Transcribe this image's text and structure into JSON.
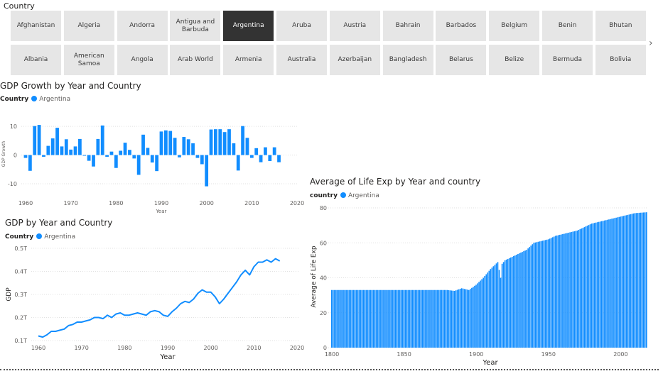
{
  "slicer": {
    "title": "Country",
    "row1": [
      "Afghanistan",
      "Algeria",
      "Andorra",
      "Antigua and Barbuda",
      "Argentina",
      "Aruba",
      "Austria",
      "Bahrain",
      "Barbados",
      "Belgium",
      "Benin",
      "Bhutan"
    ],
    "row2": [
      "Albania",
      "American Samoa",
      "Angola",
      "Arab World",
      "Armenia",
      "Australia",
      "Azerbaijan",
      "Bangladesh",
      "Belarus",
      "Belize",
      "Bermuda",
      "Bolivia"
    ],
    "selected": "Argentina",
    "next_icon": "chevron-right-icon"
  },
  "colors": {
    "accent": "#118DFF",
    "selected_tile": "#333333",
    "tile": "#E6E6E6"
  },
  "chart_data": [
    {
      "type": "bar",
      "title": "GDP Growth by Year and Country",
      "legend_title": "Country",
      "series": [
        {
          "name": "Argentina",
          "color": "#118DFF"
        }
      ],
      "xlabel": "Year",
      "ylabel": "GDP Growth",
      "xticks": [
        1960,
        1970,
        1980,
        1990,
        2000,
        2010,
        2020
      ],
      "yticks": [
        10,
        0,
        -10
      ],
      "ylim": [
        -11,
        12
      ],
      "x": [
        1960,
        1961,
        1962,
        1963,
        1964,
        1965,
        1966,
        1967,
        1968,
        1969,
        1970,
        1971,
        1972,
        1973,
        1974,
        1975,
        1976,
        1977,
        1978,
        1979,
        1980,
        1981,
        1982,
        1983,
        1984,
        1985,
        1986,
        1987,
        1988,
        1989,
        1990,
        1991,
        1992,
        1993,
        1994,
        1995,
        1996,
        1997,
        1998,
        1999,
        2000,
        2001,
        2002,
        2003,
        2004,
        2005,
        2006,
        2007,
        2008,
        2009,
        2010,
        2011,
        2012,
        2013,
        2014,
        2015,
        2016
      ],
      "values": [
        -1.0,
        -5.5,
        10.1,
        10.5,
        -0.6,
        3.2,
        5.8,
        9.5,
        3.0,
        5.5,
        1.9,
        3.0,
        5.6,
        -0.1,
        -2.0,
        -4.0,
        5.6,
        10.3,
        -0.6,
        1.2,
        -4.5,
        1.5,
        4.3,
        1.8,
        -1.2,
        -6.9,
        7.1,
        2.5,
        -2.6,
        -5.6,
        8.2,
        8.6,
        8.4,
        6.0,
        -0.8,
        6.3,
        5.5,
        4.1,
        -1.0,
        -3.2,
        -10.9,
        8.9,
        9.0,
        9.0,
        8.0,
        9.0,
        4.1,
        -5.4,
        10.1,
        6.0,
        -1.0,
        2.4,
        -2.5,
        2.7,
        -2.1,
        2.7,
        -2.5
      ]
    },
    {
      "type": "line",
      "title": "GDP by Year and Country",
      "legend_title": "Country",
      "series": [
        {
          "name": "Argentina",
          "color": "#118DFF"
        }
      ],
      "xlabel": "Year",
      "ylabel": "GDP",
      "xticks": [
        1960,
        1970,
        1980,
        1990,
        2000,
        2010,
        2020
      ],
      "yticks": [
        "0.5T",
        "0.4T",
        "0.3T",
        "0.2T",
        "0.1T"
      ],
      "ytick_values": [
        0.5,
        0.4,
        0.3,
        0.2,
        0.1
      ],
      "ylim": [
        0.1,
        0.5
      ],
      "x": [
        1960,
        1961,
        1962,
        1963,
        1964,
        1965,
        1966,
        1967,
        1968,
        1969,
        1970,
        1971,
        1972,
        1973,
        1974,
        1975,
        1976,
        1977,
        1978,
        1979,
        1980,
        1981,
        1982,
        1983,
        1984,
        1985,
        1986,
        1987,
        1988,
        1989,
        1990,
        1991,
        1992,
        1993,
        1994,
        1995,
        1996,
        1997,
        1998,
        1999,
        2000,
        2001,
        2002,
        2003,
        2004,
        2005,
        2006,
        2007,
        2008,
        2009,
        2010,
        2011,
        2012,
        2013,
        2014,
        2015,
        2016
      ],
      "values": [
        0.12,
        0.115,
        0.125,
        0.14,
        0.14,
        0.145,
        0.15,
        0.165,
        0.17,
        0.18,
        0.18,
        0.185,
        0.19,
        0.2,
        0.2,
        0.195,
        0.21,
        0.2,
        0.215,
        0.22,
        0.21,
        0.21,
        0.215,
        0.22,
        0.215,
        0.21,
        0.225,
        0.23,
        0.225,
        0.21,
        0.205,
        0.225,
        0.24,
        0.26,
        0.27,
        0.265,
        0.28,
        0.305,
        0.32,
        0.31,
        0.31,
        0.29,
        0.26,
        0.28,
        0.305,
        0.33,
        0.355,
        0.385,
        0.405,
        0.385,
        0.42,
        0.44,
        0.44,
        0.45,
        0.44,
        0.455,
        0.445
      ]
    },
    {
      "type": "bar",
      "title": "Average of Life Exp by Year and country",
      "legend_title": "country",
      "series": [
        {
          "name": "Argentina",
          "color": "#118DFF"
        }
      ],
      "xlabel": "Year",
      "ylabel": "Average of Life Exp",
      "xticks": [
        1800,
        1850,
        1900,
        1950,
        2000
      ],
      "yticks": [
        80,
        60,
        40,
        20,
        0
      ],
      "ylim": [
        0,
        80
      ],
      "xlim": [
        1800,
        2018
      ],
      "points": [
        [
          1800,
          33
        ],
        [
          1880,
          33
        ],
        [
          1885,
          32.5
        ],
        [
          1890,
          34
        ],
        [
          1895,
          33
        ],
        [
          1900,
          36
        ],
        [
          1905,
          40
        ],
        [
          1910,
          45
        ],
        [
          1915,
          49
        ],
        [
          1917,
          40
        ],
        [
          1918,
          48
        ],
        [
          1920,
          50
        ],
        [
          1925,
          52
        ],
        [
          1930,
          54
        ],
        [
          1935,
          56
        ],
        [
          1940,
          60
        ],
        [
          1945,
          61
        ],
        [
          1950,
          62
        ],
        [
          1955,
          64
        ],
        [
          1960,
          65
        ],
        [
          1965,
          66
        ],
        [
          1970,
          67
        ],
        [
          1975,
          69
        ],
        [
          1980,
          71
        ],
        [
          1985,
          72
        ],
        [
          1990,
          73
        ],
        [
          1995,
          74
        ],
        [
          2000,
          75
        ],
        [
          2005,
          76
        ],
        [
          2010,
          77
        ],
        [
          2018,
          77.5
        ]
      ]
    }
  ]
}
